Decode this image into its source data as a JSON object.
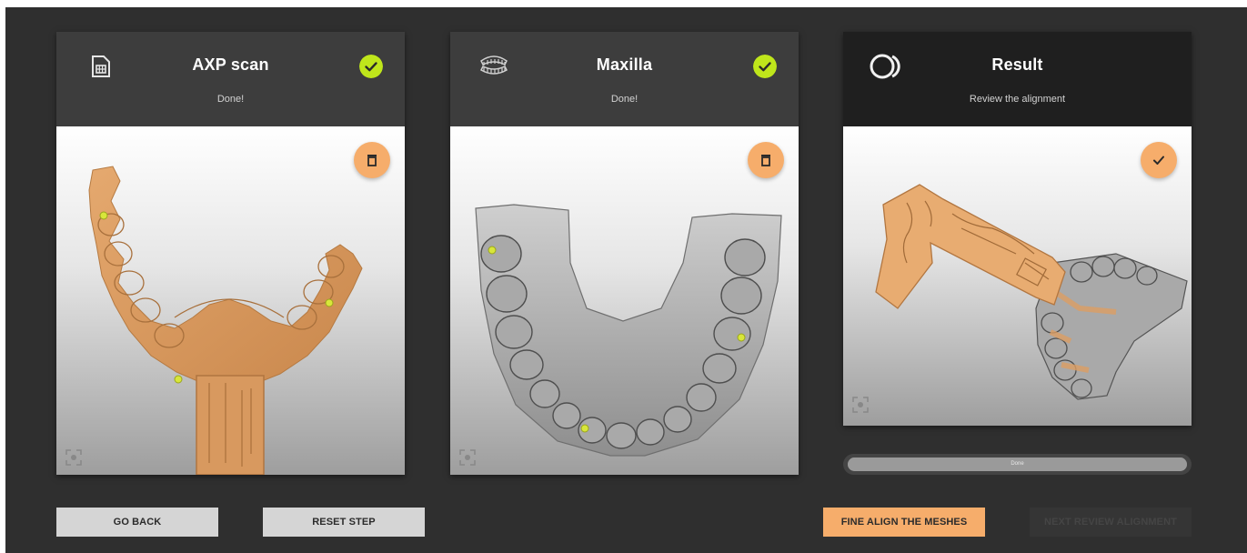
{
  "cards": [
    {
      "title": "AXP scan",
      "status": "Done!",
      "icon": "sim-card-icon",
      "complete": true,
      "action": "delete"
    },
    {
      "title": "Maxilla",
      "status": "Done!",
      "icon": "dental-arch-icon",
      "complete": true,
      "action": "delete"
    },
    {
      "title": "Result",
      "status": "Review the alignment",
      "icon": "overlap-circles-icon",
      "complete": false,
      "action": "confirm"
    }
  ],
  "progress": {
    "label": "Done",
    "fraction": 1.0
  },
  "buttons": {
    "go_back": "GO BACK",
    "reset_step": "RESET STEP",
    "fine_align": "FINE ALIGN THE MESHES",
    "next": "NEXT REVIEW ALIGNMENT"
  },
  "colors": {
    "accent": "#f6ad6b",
    "success": "#bfe61b",
    "panel": "#2f2f2f",
    "scan_mesh": "#dc9d63",
    "gypsum_mesh": "#b9b9b9"
  }
}
